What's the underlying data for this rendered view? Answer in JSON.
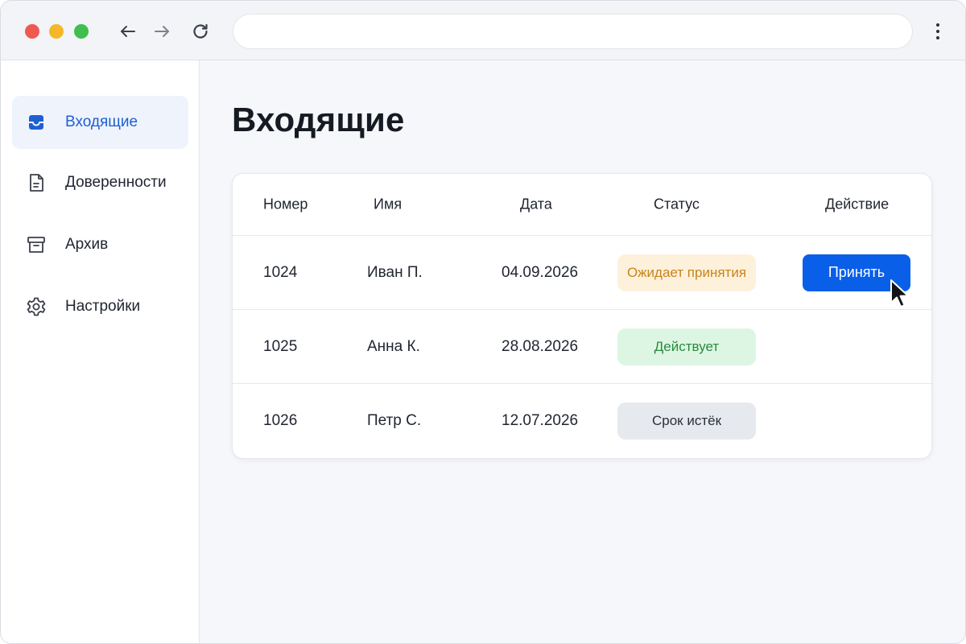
{
  "browser": {
    "address_value": "",
    "colors": {
      "close": "#ee5a52",
      "minimize": "#f3b829",
      "maximize": "#3fbf4d"
    }
  },
  "sidebar": {
    "items": [
      {
        "label": "Входящие",
        "icon": "inbox-icon",
        "active": true
      },
      {
        "label": "Доверенности",
        "icon": "document-icon",
        "active": false
      },
      {
        "label": "Архив",
        "icon": "archive-icon",
        "active": false
      },
      {
        "label": "Настройки",
        "icon": "gear-icon",
        "active": false
      }
    ]
  },
  "main": {
    "title": "Входящие",
    "table": {
      "columns": [
        "Номер",
        "Имя",
        "Дата",
        "Статус",
        "Действие"
      ],
      "rows": [
        {
          "number": "1024",
          "name": "Иван П.",
          "date": "04.09.2026",
          "status": "Ожидает принятия",
          "status_type": "pending",
          "action": "Принять"
        },
        {
          "number": "1025",
          "name": "Анна К.",
          "date": "28.08.2026",
          "status": "Действует",
          "status_type": "active",
          "action": ""
        },
        {
          "number": "1026",
          "name": "Петр С.",
          "date": "12.07.2026",
          "status": "Срок истёк",
          "status_type": "expired",
          "action": ""
        }
      ]
    }
  },
  "colors": {
    "accent": "#0a5fe8",
    "active_nav_text": "#1f5fd1",
    "pending_text": "#c88418",
    "pending_bg": "#fdf1dc",
    "active_text": "#2a8a3c",
    "active_bg": "#ddf6e3",
    "expired_bg": "#e6e9ee"
  }
}
